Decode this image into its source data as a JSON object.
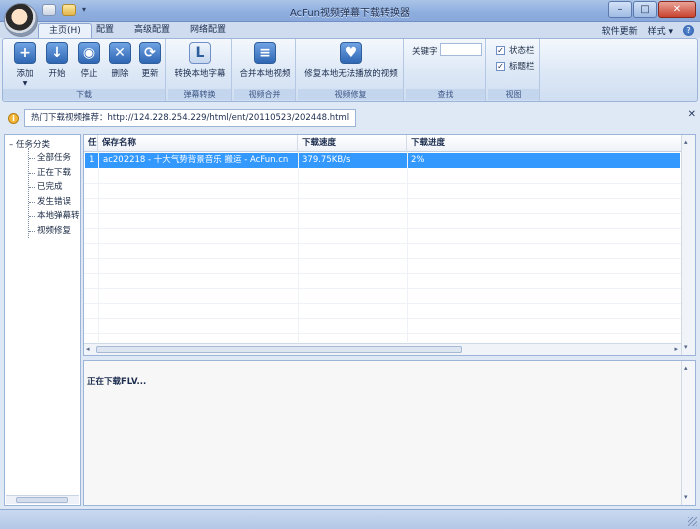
{
  "window": {
    "title": "AcFun视频弹幕下载转换器"
  },
  "tabs": [
    {
      "label": "主页(H)",
      "active": true
    },
    {
      "label": "配置",
      "active": false
    },
    {
      "label": "高级配置",
      "active": false
    },
    {
      "label": "网络配置",
      "active": false
    }
  ],
  "top_right": {
    "update": "软件更新",
    "style": "样式",
    "style_arrow": "▾",
    "help": "?"
  },
  "ribbon": {
    "download": {
      "label": "下载",
      "add": "添加",
      "start": "开始",
      "stop": "停止",
      "delete": "删除",
      "refresh": "更新"
    },
    "danmaku": {
      "label": "弹幕转换",
      "convert": "转换本地字幕"
    },
    "merge": {
      "label": "视频合并",
      "merge_local": "合并本地视频"
    },
    "repair": {
      "label": "视频修复",
      "repair_local": "修复本地无法播放的视频"
    },
    "search": {
      "label": "查找",
      "keyword": "关键字",
      "keyword_value": ""
    },
    "view": {
      "label": "视图",
      "statusbar": "状态栏",
      "titlebar": "标题栏",
      "statusbar_checked": true,
      "titlebar_checked": true
    }
  },
  "info": {
    "text": "热门下载视频推荐：http://124.228.254.229/html/ent/20110523/202448.html",
    "close": "✕"
  },
  "tree": {
    "root": "任务分类",
    "items": [
      "全部任务",
      "正在下载",
      "已完成",
      "发生错误",
      "本地弹幕转",
      "视频修复"
    ]
  },
  "list": {
    "columns": [
      "任",
      "保存名称",
      "下载速度",
      "下载进度"
    ],
    "rows": [
      {
        "index": "1",
        "name": "ac202218 - 十大气势背景音乐 搬运 - AcFun.cn",
        "speed": "379.75KB/s",
        "progress": "2%",
        "selected": true
      }
    ]
  },
  "log": {
    "text": "正在下载FLV..."
  },
  "colors": {
    "accent": "#3399ff",
    "ribbon_bg": "#dde8f6",
    "close_btn": "#c8432f"
  }
}
